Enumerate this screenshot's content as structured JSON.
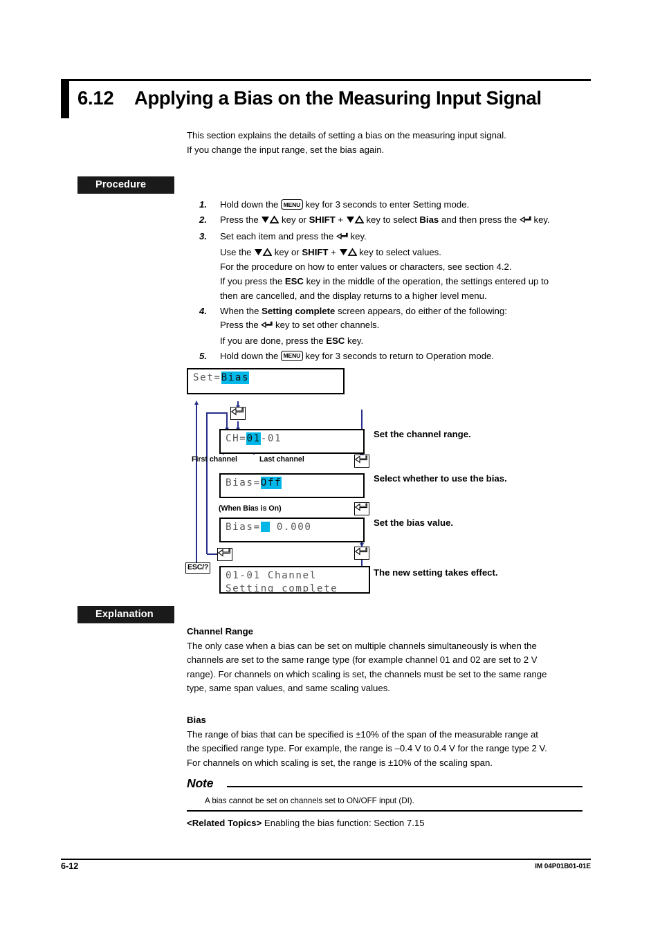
{
  "title": {
    "number": "6.12",
    "text": "Applying a Bias on the Measuring Input Signal"
  },
  "intro": {
    "line1": "This section explains the details of setting a bias on the measuring input signal.",
    "line2": "If you change the input range, set the bias again."
  },
  "sections": {
    "procedure": "Procedure",
    "explanation": "Explanation"
  },
  "keys": {
    "menu": "MENU",
    "shift": "SHIFT",
    "esc": "ESC",
    "esc_help": "ESC/?",
    "enter_icon": "enter-key-icon",
    "updown_icon": "up-down-triangle-icon"
  },
  "steps": [
    {
      "num": "1.",
      "lines": [
        {
          "pre": "Hold down the ",
          "key": "MENU",
          "post": " key for 3 seconds to enter Setting mode."
        }
      ]
    },
    {
      "num": "2.",
      "lines": [
        {
          "pre": "Press the ",
          "updown": true,
          "mid1": " key or ",
          "bold1": "SHIFT",
          "mid2": " + ",
          "updown2": true,
          "mid3": " key to select ",
          "bold2": "Bias",
          "mid4": " and then press the ",
          "enter": true,
          "post": " key."
        }
      ]
    },
    {
      "num": "3.",
      "lines": [
        {
          "pre": "Set each item and press the ",
          "enter": true,
          "post": " key."
        },
        {
          "pre": "Use the ",
          "updown": true,
          "mid1": " key or ",
          "bold1": "SHIFT",
          "mid2": " + ",
          "updown2": true,
          "post": " key to select values."
        },
        {
          "plain": "For the procedure on how to enter values or characters, see section 4.2."
        },
        {
          "pre": "If you press the ",
          "bold1": "ESC",
          "post": " key in the middle of the operation, the settings entered up to"
        },
        {
          "plain": "then are cancelled, and the display returns to a higher level menu."
        }
      ]
    },
    {
      "num": "4.",
      "lines": [
        {
          "pre": "When the ",
          "bold1": "Setting complete",
          "post": " screen appears, do either of the following:"
        },
        {
          "pre": "Press the ",
          "enter": true,
          "post": " key to set other channels."
        },
        {
          "pre": "If you are done, press the ",
          "bold1": "ESC",
          "post": " key."
        }
      ]
    },
    {
      "num": "5.",
      "lines": [
        {
          "pre": "Hold down the ",
          "key": "MENU",
          "post": " key for 3 seconds to return to Operation mode."
        }
      ]
    }
  ],
  "flow": {
    "screens": [
      {
        "id": "set-bias",
        "rows": [
          {
            "plain": "Set=",
            "highlight": "Bias"
          }
        ],
        "caption": ""
      },
      {
        "id": "channel-range",
        "rows": [
          {
            "plain": "CH=",
            "highlight": "01",
            "after": "-01"
          }
        ],
        "caption": "Set the channel range."
      },
      {
        "id": "bias-onoff",
        "rows": [
          {
            "plain": "Bias=",
            "highlight": "Off"
          }
        ],
        "caption": "Select whether to use the bias."
      },
      {
        "id": "bias-value",
        "rows": [
          {
            "plain": "Bias=",
            "cursor": true,
            "after": " 0.000"
          }
        ],
        "caption": "Set the bias value."
      },
      {
        "id": "setting-complete",
        "rows": [
          {
            "plain": "01-01 Channel"
          },
          {
            "plain": "Setting complete"
          }
        ],
        "caption": "The new setting takes effect."
      }
    ],
    "annotations": {
      "first_channel": "First channel",
      "last_channel": "Last channel",
      "when_bias_on": "(When Bias is On)"
    }
  },
  "explanation": {
    "channel_range": {
      "heading": "Channel Range",
      "lines": [
        "The only case when a bias can be set on multiple channels simultaneously is when the",
        "channels are set to the same range type (for example channel 01 and 02 are set to 2 V",
        "range). For channels on which scaling is set, the channels must be set to the same range",
        "type, same span values, and same scaling values."
      ]
    },
    "bias": {
      "heading": "Bias",
      "lines": [
        "The range of bias that can be specified is ±10% of the span of the measurable range at",
        "the specified range type. For example, the range is –0.4 V to 0.4 V for the range type 2 V.",
        "For channels on which scaling is set, the range is ±10% of the scaling span."
      ]
    }
  },
  "note": {
    "title": "Note",
    "body": "A bias cannot be set on channels set to ON/OFF input (DI)."
  },
  "related": {
    "label": "<Related Topics>",
    "text": "Enabling the bias function: Section 7.15"
  },
  "footer": {
    "page": "6-12",
    "doc_id": "IM 04P01B01-01E"
  },
  "colors": {
    "highlight": "#00b7e8",
    "line": "#26308c",
    "heading_bg": "#1a1a1a"
  }
}
